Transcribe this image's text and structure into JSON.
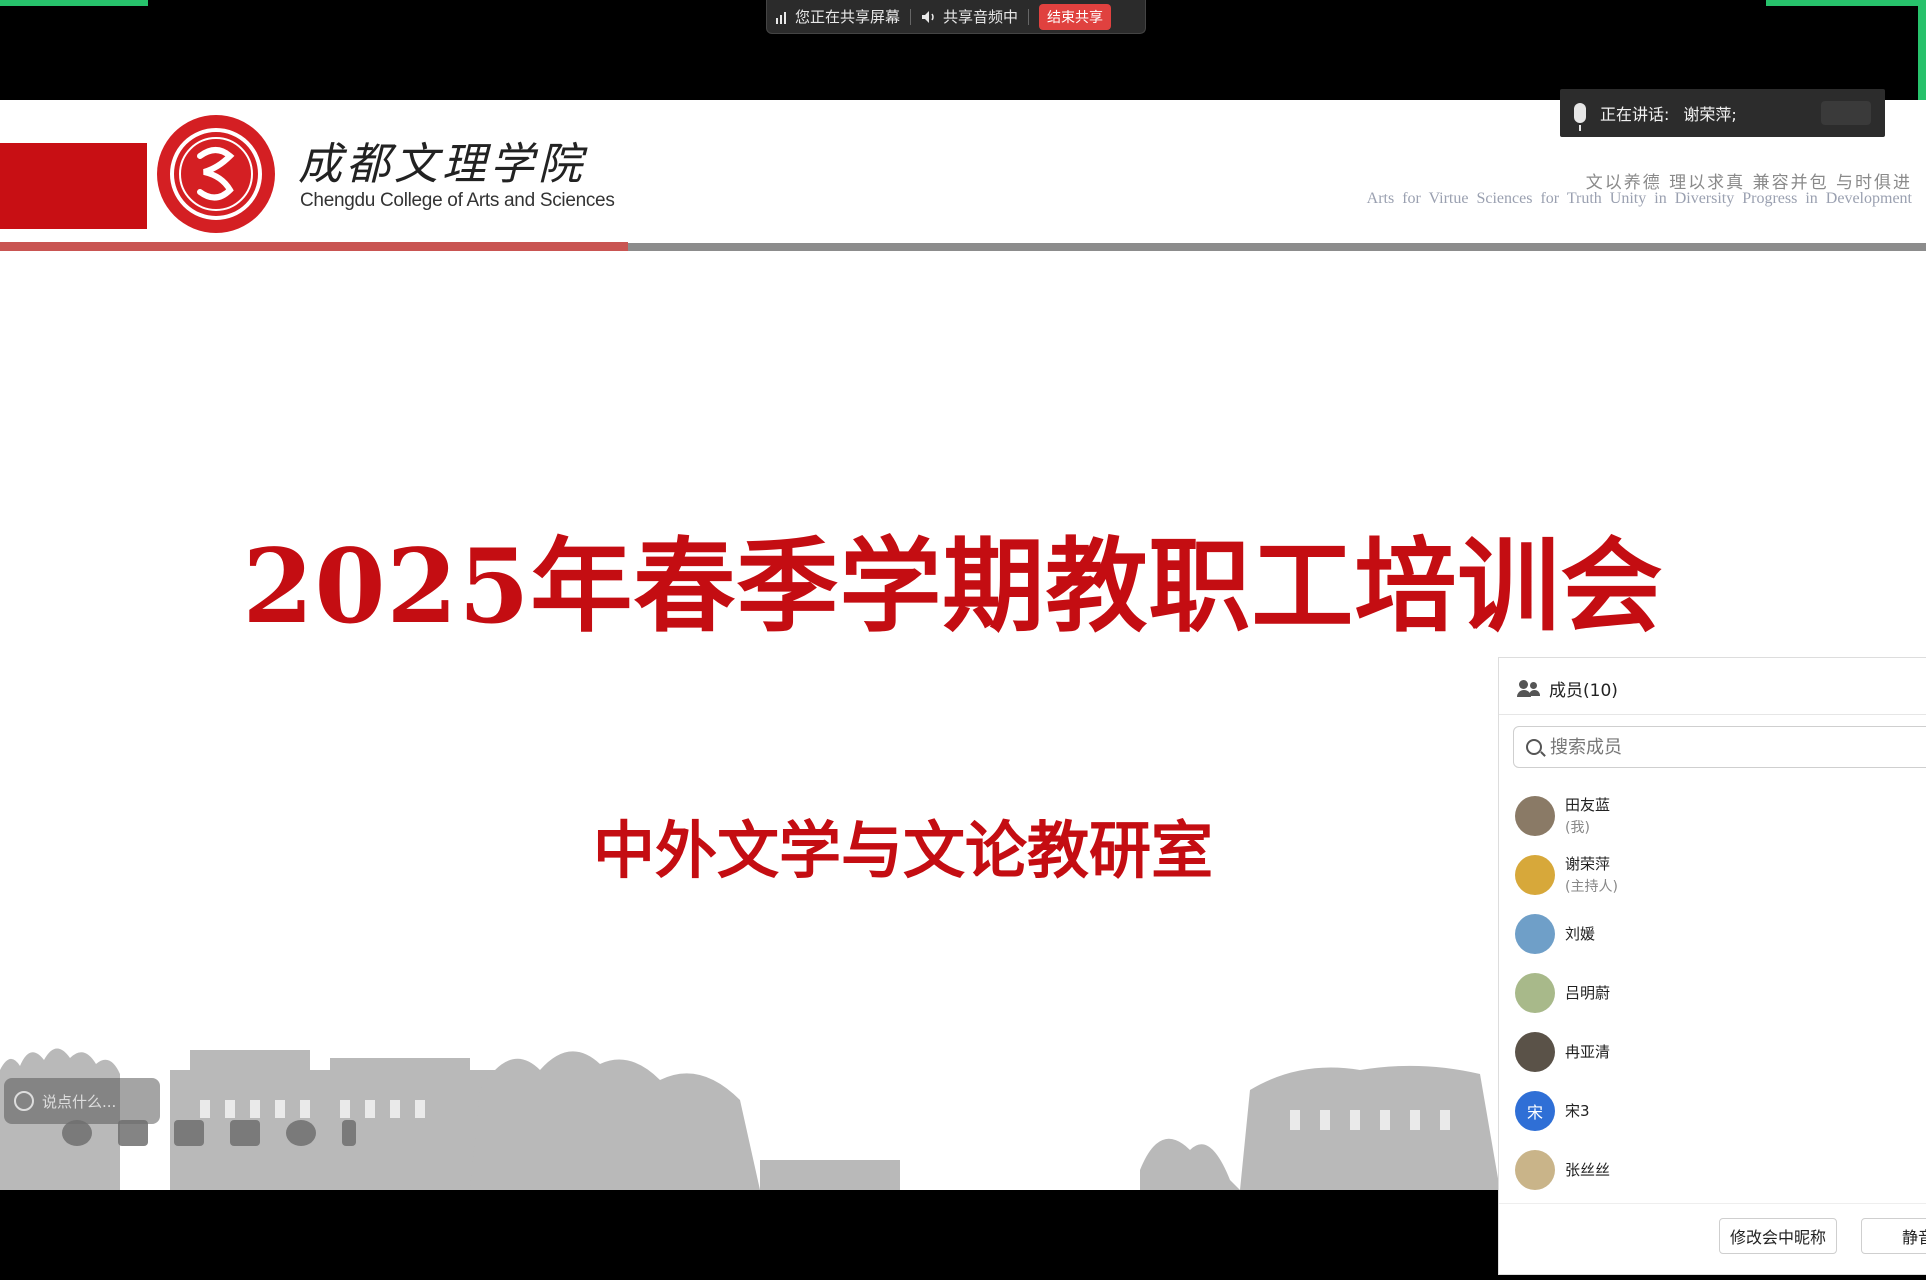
{
  "share_bar": {
    "sharing_label": "您正在共享屏幕",
    "audio_label": "共享音频中",
    "end_label": "结束共享"
  },
  "slide": {
    "school_name_cn": "成都文理学院",
    "school_name_en": "Chengdu College of Arts and Sciences",
    "motto_cn": "文以养德  理以求真  兼容并包  与时俱进",
    "motto_en": "Arts for Virtue   Sciences for Truth   Unity in Diversity   Progress in Development",
    "title": "2025年春季学期教职工培训会",
    "subtitle": "中外文学与文论教研室",
    "colors": {
      "brand_red": "#c40d12",
      "header_gray": "#8c8c8c"
    }
  },
  "chat": {
    "placeholder": "说点什么..."
  },
  "speaking": {
    "label": "正在讲话:",
    "name": "谢荣萍;"
  },
  "members": {
    "title": "成员(10)",
    "search_placeholder": "搜索成员",
    "list": [
      {
        "name": "田友蓝",
        "role": "(我)",
        "avatar_color": "#8a7a66",
        "avatar_text": ""
      },
      {
        "name": "谢荣萍",
        "role": "(主持人)",
        "avatar_color": "#d7a83a",
        "avatar_text": ""
      },
      {
        "name": "刘媛",
        "role": "",
        "avatar_color": "#6f9fc8",
        "avatar_text": ""
      },
      {
        "name": "吕明蔚",
        "role": "",
        "avatar_color": "#a8b98a",
        "avatar_text": ""
      },
      {
        "name": "冉亚清",
        "role": "",
        "avatar_color": "#5a5248",
        "avatar_text": ""
      },
      {
        "name": "宋3",
        "role": "",
        "avatar_color": "#2f6fd6",
        "avatar_text": "宋"
      },
      {
        "name": "张丝丝",
        "role": "",
        "avatar_color": "#c9b489",
        "avatar_text": ""
      }
    ],
    "rename_label": "修改会中昵称",
    "mute_label": "静音"
  }
}
